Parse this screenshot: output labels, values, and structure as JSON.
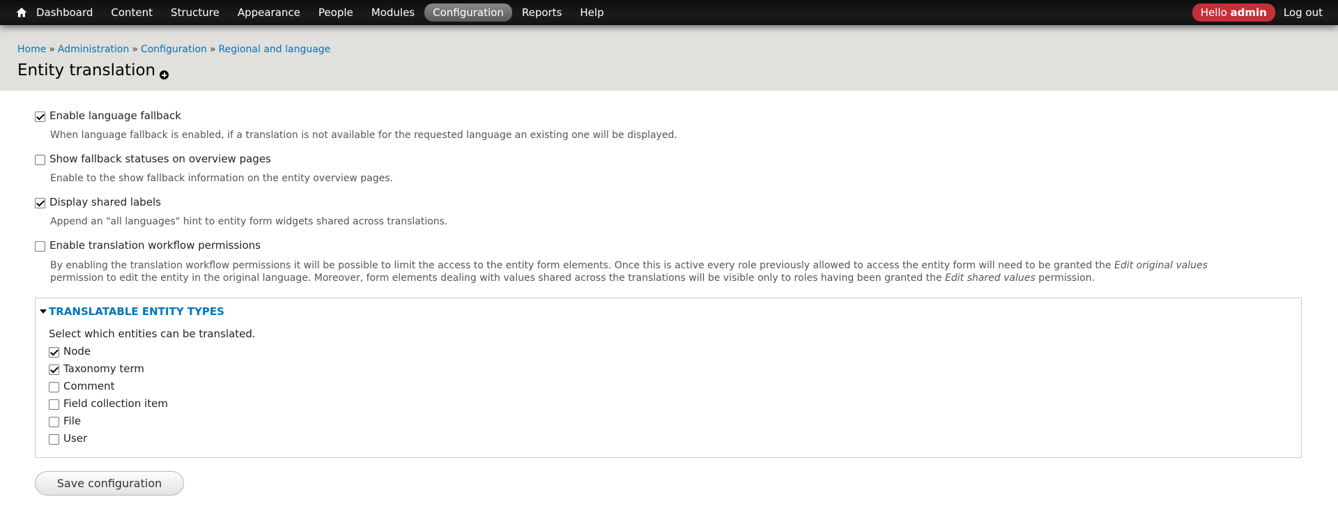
{
  "toolbar": {
    "home_icon": "home-icon",
    "menu": [
      {
        "label": "Dashboard",
        "active": false
      },
      {
        "label": "Content",
        "active": false
      },
      {
        "label": "Structure",
        "active": false
      },
      {
        "label": "Appearance",
        "active": false
      },
      {
        "label": "People",
        "active": false
      },
      {
        "label": "Modules",
        "active": false
      },
      {
        "label": "Configuration",
        "active": true
      },
      {
        "label": "Reports",
        "active": false
      },
      {
        "label": "Help",
        "active": false
      }
    ],
    "hello_prefix": "Hello",
    "username": "admin",
    "logout_label": "Log out",
    "hello_color": "#c4303a"
  },
  "breadcrumb": {
    "items": [
      "Home",
      "Administration",
      "Configuration",
      "Regional and language"
    ],
    "separator": "»"
  },
  "page": {
    "title": "Entity translation"
  },
  "options": [
    {
      "label": "Enable language fallback",
      "checked": true,
      "description": "When language fallback is enabled, if a translation is not available for the requested language an existing one will be displayed."
    },
    {
      "label": "Show fallback statuses on overview pages",
      "checked": false,
      "description": "Enable to the show fallback information on the entity overview pages."
    },
    {
      "label": "Display shared labels",
      "checked": true,
      "description": "Append an \"all languages\" hint to entity form widgets shared across translations."
    },
    {
      "label": "Enable translation workflow permissions",
      "checked": false,
      "description_line1_a": "By enabling the translation workflow permissions it will be possible to limit the access to the entity form elements. Once this is active every role previously allowed to access the entity form will need to be granted the ",
      "description_line1_em": "Edit original values",
      "description_line2_a": "permission to edit the entity in the original language. Moreover, form elements dealing with values shared across the translations will be visible only to roles having been granted the ",
      "description_line2_em": "Edit shared values",
      "description_line2_b": " permission."
    }
  ],
  "translatable": {
    "legend": "TRANSLATABLE ENTITY TYPES",
    "help": "Select which entities can be translated.",
    "items": [
      {
        "label": "Node",
        "checked": true
      },
      {
        "label": "Taxonomy term",
        "checked": true
      },
      {
        "label": "Comment",
        "checked": false
      },
      {
        "label": "Field collection item",
        "checked": false
      },
      {
        "label": "File",
        "checked": false
      },
      {
        "label": "User",
        "checked": false
      }
    ]
  },
  "actions": {
    "save_label": "Save configuration"
  },
  "colors": {
    "link": "#0074bd",
    "header_band": "#e1e0dc"
  }
}
